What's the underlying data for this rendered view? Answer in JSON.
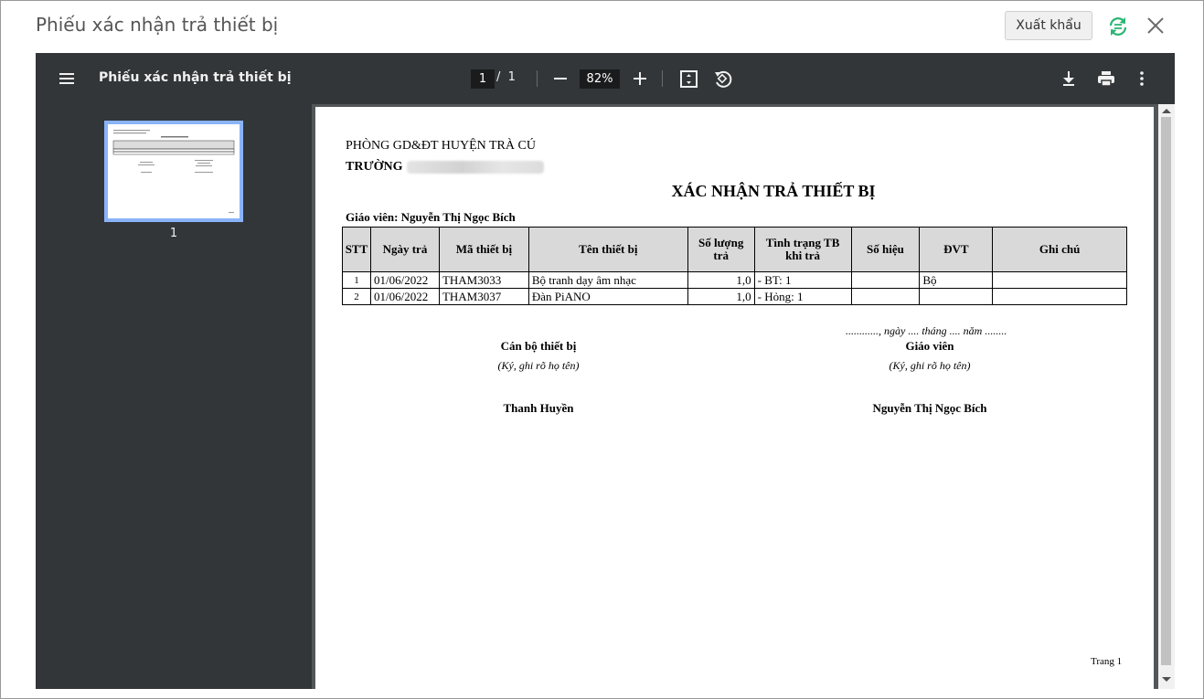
{
  "dialog": {
    "title": "Phiếu xác nhận trả thiết bị",
    "export_label": "Xuất khẩu"
  },
  "viewer": {
    "toolbar": {
      "doc_title": "Phiếu xác nhận trả thiết bị",
      "current_page": "1",
      "page_separator": "/",
      "total_pages": "1",
      "zoom": "82%"
    },
    "thumbnail_number": "1"
  },
  "document": {
    "org": "PHÒNG GD&ĐT HUYỆN TRÀ CÚ",
    "school_label": "TRƯỜNG",
    "title": "XÁC NHẬN TRẢ THIẾT BỊ",
    "teacher_line": "Giáo viên: Nguyễn Thị Ngọc Bích",
    "columns": [
      "STT",
      "Ngày trả",
      "Mã thiết bị",
      "Tên thiết bị",
      "Số lượng trả",
      "Tình trạng TB khi trả",
      "Số hiệu",
      "ĐVT",
      "Ghi chú"
    ],
    "rows": [
      [
        "1",
        "01/06/2022",
        "THAM3033",
        "Bộ tranh dạy âm nhạc",
        "1,0",
        "- BT: 1",
        "",
        "Bộ",
        ""
      ],
      [
        "2",
        "01/06/2022",
        "THAM3037",
        "Đàn PiANO",
        "1,0",
        "- Hỏng: 1",
        "",
        "",
        ""
      ]
    ],
    "date_line": "............, ngày .... tháng .... năm ........",
    "signers": [
      {
        "role": "Cán bộ thiết bị",
        "note": "(Ký, ghi rõ họ tên)",
        "name": "Thanh Huyền"
      },
      {
        "role": "Giáo viên",
        "note": "(Ký, ghi rõ họ tên)",
        "name": "Nguyễn Thị Ngọc Bích"
      }
    ],
    "footer": "Trang 1"
  },
  "colors": {
    "toolbar_bg": "#323639",
    "viewer_bg": "#525659",
    "thumb_border": "#8ab4f8",
    "sync_icon": "#2bb673",
    "table_header_bg": "#d9d9d9"
  }
}
